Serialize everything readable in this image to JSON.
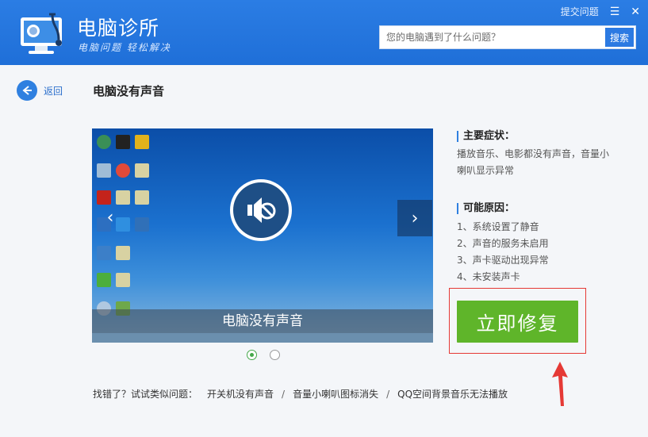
{
  "header": {
    "title": "电脑诊所",
    "slogan": "电脑问题 轻松解决",
    "feedback_link": "提交问题",
    "menu_icon": "menu-icon",
    "close_icon": "close-icon"
  },
  "search": {
    "placeholder": "您的电脑遇到了什么问题？",
    "button_label": "搜索"
  },
  "nav": {
    "back_label": "返回"
  },
  "page": {
    "title": "电脑没有声音"
  },
  "carousel": {
    "caption": "电脑没有声音",
    "prev_icon": "chevron-left-icon",
    "next_icon": "chevron-right-icon",
    "slide_count": 2,
    "active_index": 0
  },
  "symptoms": {
    "title": "主要症状：",
    "text": "播放音乐、电影都没有声音，音量小喇叭显示异常"
  },
  "causes": {
    "title": "可能原因：",
    "items": [
      "1、系统设置了静音",
      "2、声音的服务未启用",
      "3、声卡驱动出现异常",
      "4、未安装声卡"
    ]
  },
  "fix": {
    "button_label": "立即修复"
  },
  "related": {
    "label": "找错了？试试类似问题：",
    "links": [
      "开关机没有声音",
      "音量小喇叭图标消失",
      "QQ空间背景音乐无法播放"
    ],
    "separator": "/"
  },
  "colors": {
    "header_blue": "#1f6fd8",
    "fix_green": "#5fb52a",
    "highlight_red": "#e53935"
  }
}
